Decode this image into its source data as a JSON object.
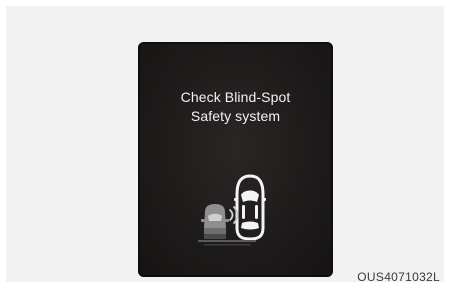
{
  "display": {
    "message_line1": "Check Blind-Spot",
    "message_line2": "Safety system"
  },
  "figure_code": "OUS4071032L"
}
